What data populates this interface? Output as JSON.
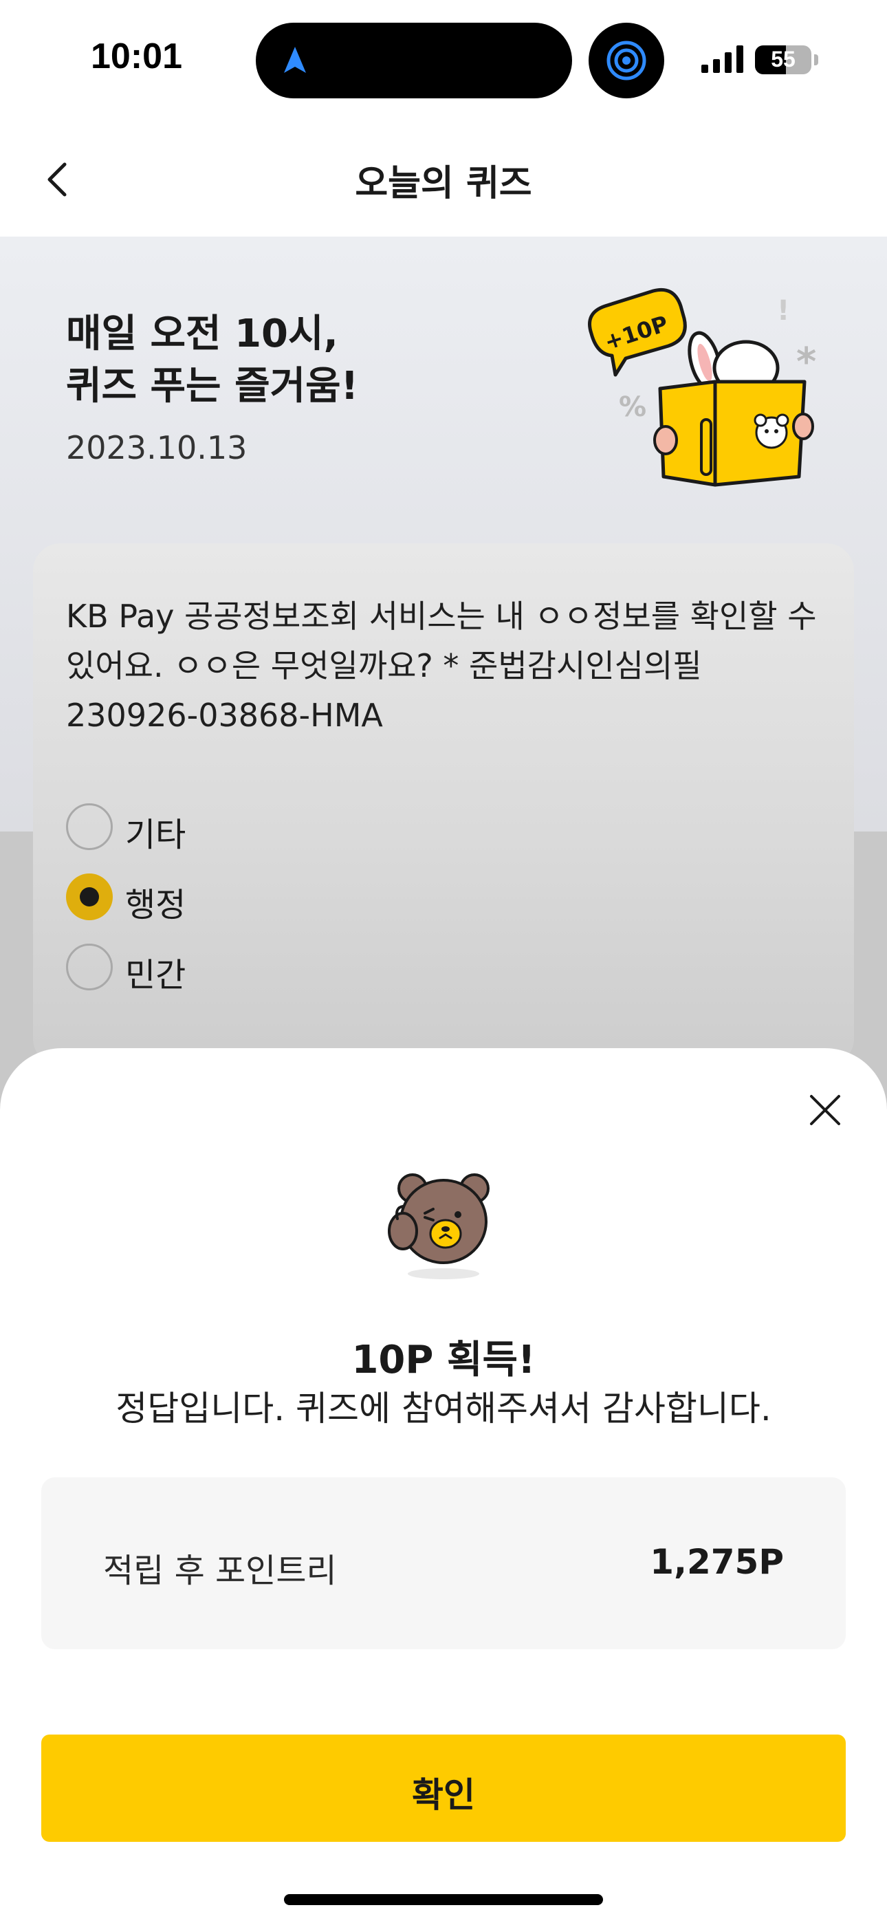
{
  "status_bar": {
    "time": "10:01",
    "battery": "55",
    "battery_level": 0.55
  },
  "header": {
    "title": "오늘의 퀴즈"
  },
  "hero": {
    "title_line1": "매일 오전 10시,",
    "title_line2": "퀴즈 푸는 즐거움!",
    "date": "2023.10.13",
    "badge": "+10P"
  },
  "quiz": {
    "question": "KB Pay 공공정보조회 서비스는 내 ㅇㅇ정보를 확인할 수 있어요. ㅇㅇ은 무엇일까요? * 준법감시인심의필 230926-03868-HMA",
    "options": [
      {
        "label": "기타",
        "selected": false
      },
      {
        "label": "행정",
        "selected": true
      },
      {
        "label": "민간",
        "selected": false
      }
    ]
  },
  "result_sheet": {
    "title": "10P 획득!",
    "message": "정답입니다. 퀴즈에 참여해주셔서 감사합니다.",
    "points_label": "적립 후 포인트리",
    "points_value": "1,275P",
    "confirm_label": "확인"
  },
  "colors": {
    "accent": "#fecb00",
    "selected_radio": "#dfae0d"
  }
}
